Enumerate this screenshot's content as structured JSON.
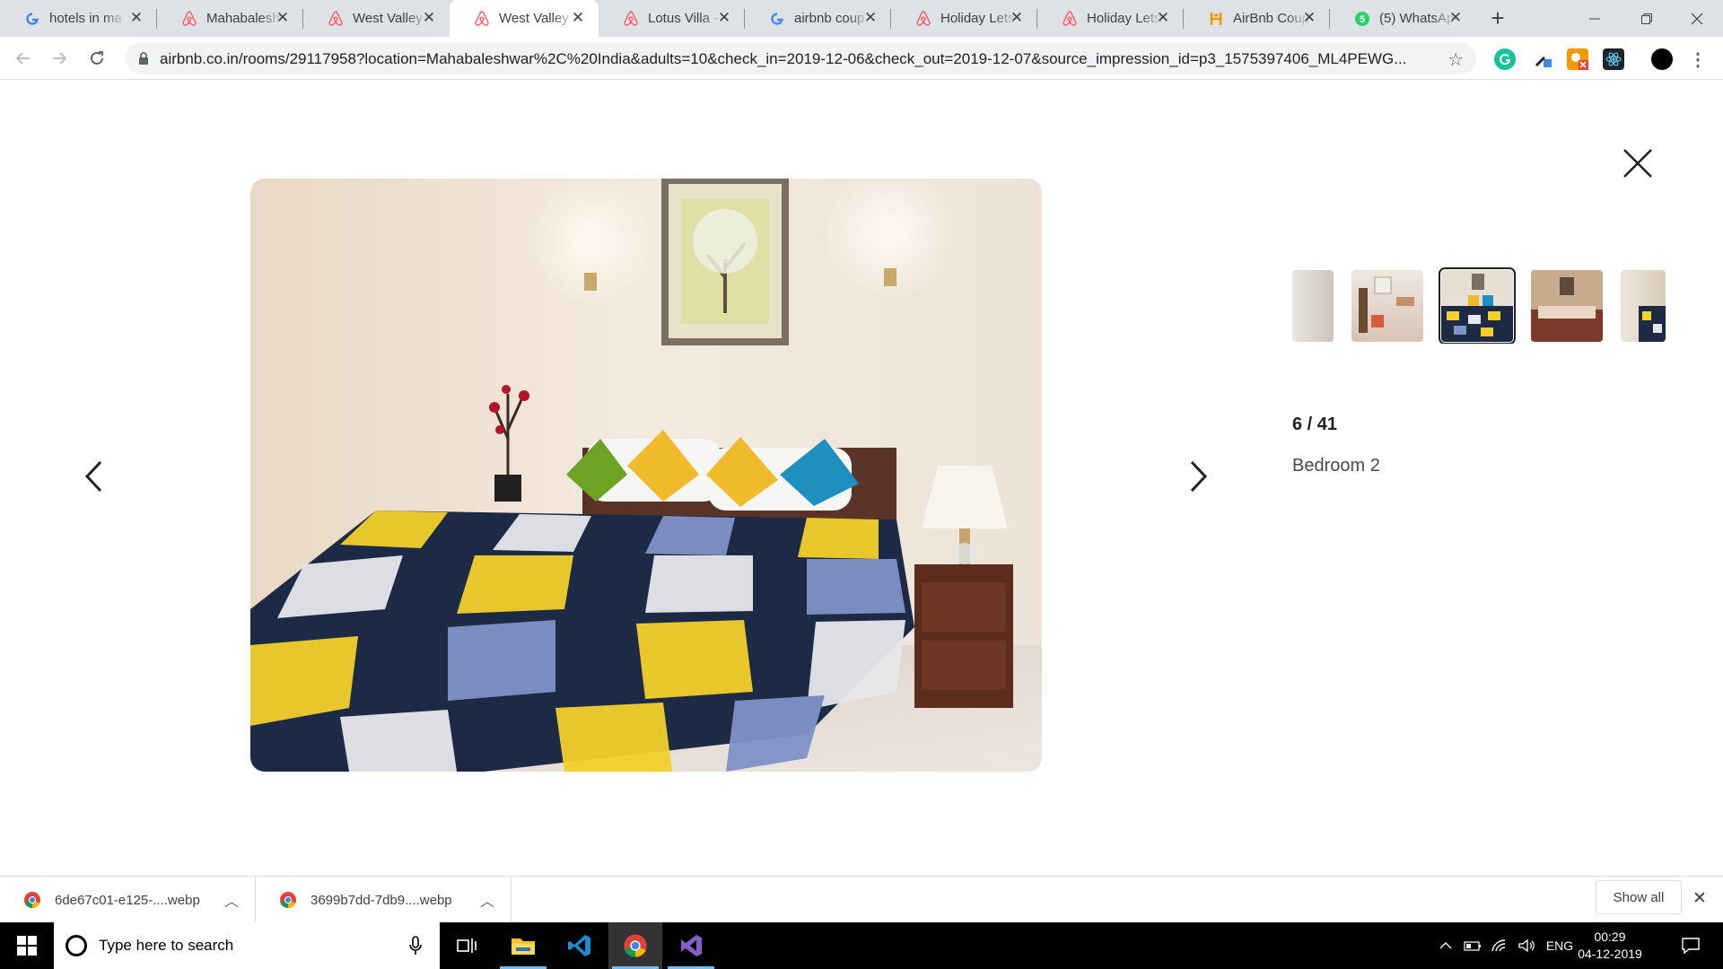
{
  "browser": {
    "tabs": [
      {
        "title": "hotels in ma",
        "favicon": "google-icon"
      },
      {
        "title": "Mahabalesh",
        "favicon": "airbnb-icon"
      },
      {
        "title": "West Valley",
        "favicon": "airbnb-icon"
      },
      {
        "title": "West Valley",
        "favicon": "airbnb-icon",
        "active": true
      },
      {
        "title": "Lotus Villa -",
        "favicon": "airbnb-icon"
      },
      {
        "title": "airbnb coup",
        "favicon": "google-icon"
      },
      {
        "title": "Holiday Lets",
        "favicon": "airbnb-icon"
      },
      {
        "title": "Holiday Lets",
        "favicon": "airbnb-icon"
      },
      {
        "title": "AirBnb Coup",
        "favicon": "hotel-icon"
      },
      {
        "title": "(5) WhatsAp",
        "favicon": "whatsapp-icon"
      }
    ],
    "url": "airbnb.co.in/rooms/29117958?location=Mahabaleshwar%2C%20India&adults=10&check_in=2019-12-06&check_out=2019-12-07&source_impression_id=p3_1575397406_ML4PEWG...",
    "colors": {
      "tabstrip": "#dee1e6",
      "omnibox": "#f1f3f4"
    }
  },
  "gallery": {
    "counter": "6 / 41",
    "caption": "Bedroom 2",
    "selected_thumb": 3
  },
  "downloads": {
    "items": [
      {
        "name": "6de67c01-e125-....webp"
      },
      {
        "name": "3699b7dd-7db9....webp"
      }
    ],
    "show_all": "Show all"
  },
  "taskbar": {
    "search_placeholder": "Type here to search",
    "language": "ENG",
    "time": "00:29",
    "date": "04-12-2019"
  }
}
